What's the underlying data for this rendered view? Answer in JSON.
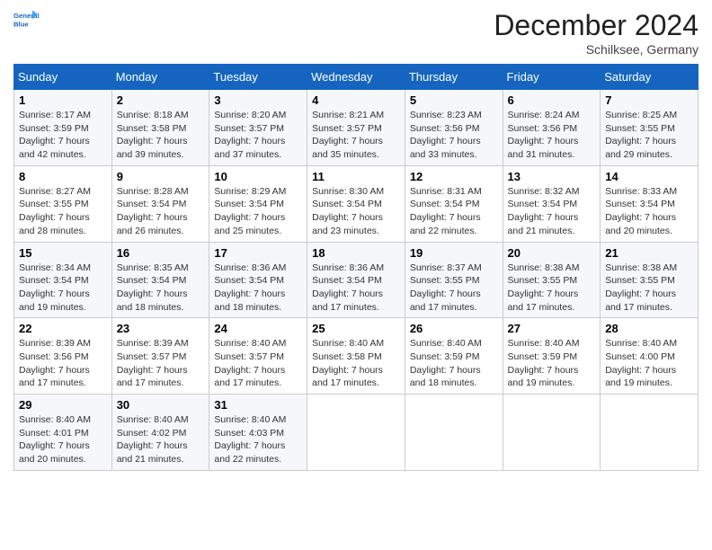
{
  "header": {
    "logo_line1": "General",
    "logo_line2": "Blue",
    "month": "December 2024",
    "location": "Schilksee, Germany"
  },
  "weekdays": [
    "Sunday",
    "Monday",
    "Tuesday",
    "Wednesday",
    "Thursday",
    "Friday",
    "Saturday"
  ],
  "weeks": [
    [
      {
        "day": "1",
        "sunrise": "8:17 AM",
        "sunset": "3:59 PM",
        "daylight": "7 hours and 42 minutes."
      },
      {
        "day": "2",
        "sunrise": "8:18 AM",
        "sunset": "3:58 PM",
        "daylight": "7 hours and 39 minutes."
      },
      {
        "day": "3",
        "sunrise": "8:20 AM",
        "sunset": "3:57 PM",
        "daylight": "7 hours and 37 minutes."
      },
      {
        "day": "4",
        "sunrise": "8:21 AM",
        "sunset": "3:57 PM",
        "daylight": "7 hours and 35 minutes."
      },
      {
        "day": "5",
        "sunrise": "8:23 AM",
        "sunset": "3:56 PM",
        "daylight": "7 hours and 33 minutes."
      },
      {
        "day": "6",
        "sunrise": "8:24 AM",
        "sunset": "3:56 PM",
        "daylight": "7 hours and 31 minutes."
      },
      {
        "day": "7",
        "sunrise": "8:25 AM",
        "sunset": "3:55 PM",
        "daylight": "7 hours and 29 minutes."
      }
    ],
    [
      {
        "day": "8",
        "sunrise": "8:27 AM",
        "sunset": "3:55 PM",
        "daylight": "7 hours and 28 minutes."
      },
      {
        "day": "9",
        "sunrise": "8:28 AM",
        "sunset": "3:54 PM",
        "daylight": "7 hours and 26 minutes."
      },
      {
        "day": "10",
        "sunrise": "8:29 AM",
        "sunset": "3:54 PM",
        "daylight": "7 hours and 25 minutes."
      },
      {
        "day": "11",
        "sunrise": "8:30 AM",
        "sunset": "3:54 PM",
        "daylight": "7 hours and 23 minutes."
      },
      {
        "day": "12",
        "sunrise": "8:31 AM",
        "sunset": "3:54 PM",
        "daylight": "7 hours and 22 minutes."
      },
      {
        "day": "13",
        "sunrise": "8:32 AM",
        "sunset": "3:54 PM",
        "daylight": "7 hours and 21 minutes."
      },
      {
        "day": "14",
        "sunrise": "8:33 AM",
        "sunset": "3:54 PM",
        "daylight": "7 hours and 20 minutes."
      }
    ],
    [
      {
        "day": "15",
        "sunrise": "8:34 AM",
        "sunset": "3:54 PM",
        "daylight": "7 hours and 19 minutes."
      },
      {
        "day": "16",
        "sunrise": "8:35 AM",
        "sunset": "3:54 PM",
        "daylight": "7 hours and 18 minutes."
      },
      {
        "day": "17",
        "sunrise": "8:36 AM",
        "sunset": "3:54 PM",
        "daylight": "7 hours and 18 minutes."
      },
      {
        "day": "18",
        "sunrise": "8:36 AM",
        "sunset": "3:54 PM",
        "daylight": "7 hours and 17 minutes."
      },
      {
        "day": "19",
        "sunrise": "8:37 AM",
        "sunset": "3:55 PM",
        "daylight": "7 hours and 17 minutes."
      },
      {
        "day": "20",
        "sunrise": "8:38 AM",
        "sunset": "3:55 PM",
        "daylight": "7 hours and 17 minutes."
      },
      {
        "day": "21",
        "sunrise": "8:38 AM",
        "sunset": "3:55 PM",
        "daylight": "7 hours and 17 minutes."
      }
    ],
    [
      {
        "day": "22",
        "sunrise": "8:39 AM",
        "sunset": "3:56 PM",
        "daylight": "7 hours and 17 minutes."
      },
      {
        "day": "23",
        "sunrise": "8:39 AM",
        "sunset": "3:57 PM",
        "daylight": "7 hours and 17 minutes."
      },
      {
        "day": "24",
        "sunrise": "8:40 AM",
        "sunset": "3:57 PM",
        "daylight": "7 hours and 17 minutes."
      },
      {
        "day": "25",
        "sunrise": "8:40 AM",
        "sunset": "3:58 PM",
        "daylight": "7 hours and 17 minutes."
      },
      {
        "day": "26",
        "sunrise": "8:40 AM",
        "sunset": "3:59 PM",
        "daylight": "7 hours and 18 minutes."
      },
      {
        "day": "27",
        "sunrise": "8:40 AM",
        "sunset": "3:59 PM",
        "daylight": "7 hours and 19 minutes."
      },
      {
        "day": "28",
        "sunrise": "8:40 AM",
        "sunset": "4:00 PM",
        "daylight": "7 hours and 19 minutes."
      }
    ],
    [
      {
        "day": "29",
        "sunrise": "8:40 AM",
        "sunset": "4:01 PM",
        "daylight": "7 hours and 20 minutes."
      },
      {
        "day": "30",
        "sunrise": "8:40 AM",
        "sunset": "4:02 PM",
        "daylight": "7 hours and 21 minutes."
      },
      {
        "day": "31",
        "sunrise": "8:40 AM",
        "sunset": "4:03 PM",
        "daylight": "7 hours and 22 minutes."
      },
      null,
      null,
      null,
      null
    ]
  ],
  "labels": {
    "sunrise": "Sunrise:",
    "sunset": "Sunset:",
    "daylight": "Daylight:"
  }
}
